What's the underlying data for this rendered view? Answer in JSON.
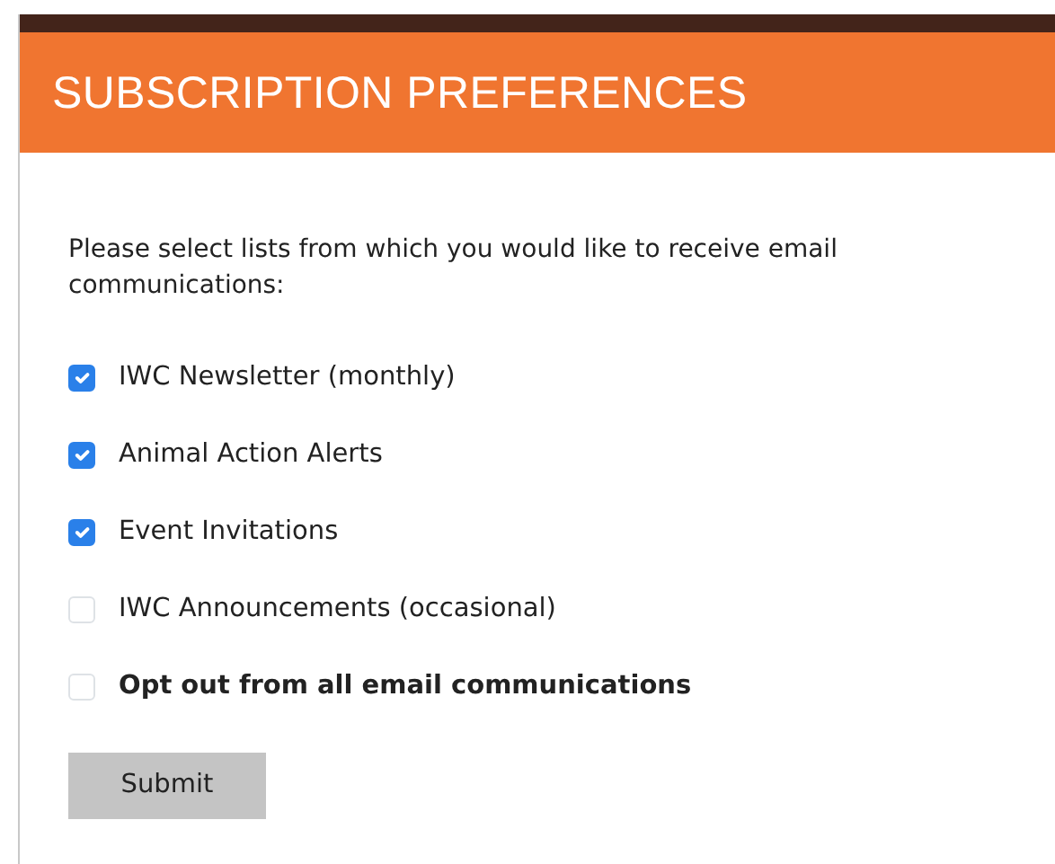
{
  "header": {
    "title": "SUBSCRIPTION PREFERENCES"
  },
  "intro": "Please select lists from which you would like to receive email communications:",
  "options": [
    {
      "kind": "list",
      "label": "IWC Newsletter (monthly)",
      "checked": true
    },
    {
      "kind": "list",
      "label": "Animal Action Alerts",
      "checked": true
    },
    {
      "kind": "list",
      "label": "Event Invitations",
      "checked": true
    },
    {
      "kind": "list",
      "label": "IWC Announcements (occasional)",
      "checked": false
    },
    {
      "kind": "opt_out",
      "label": "Opt out from all email communications",
      "checked": false
    }
  ],
  "submit": {
    "label": "Submit"
  }
}
